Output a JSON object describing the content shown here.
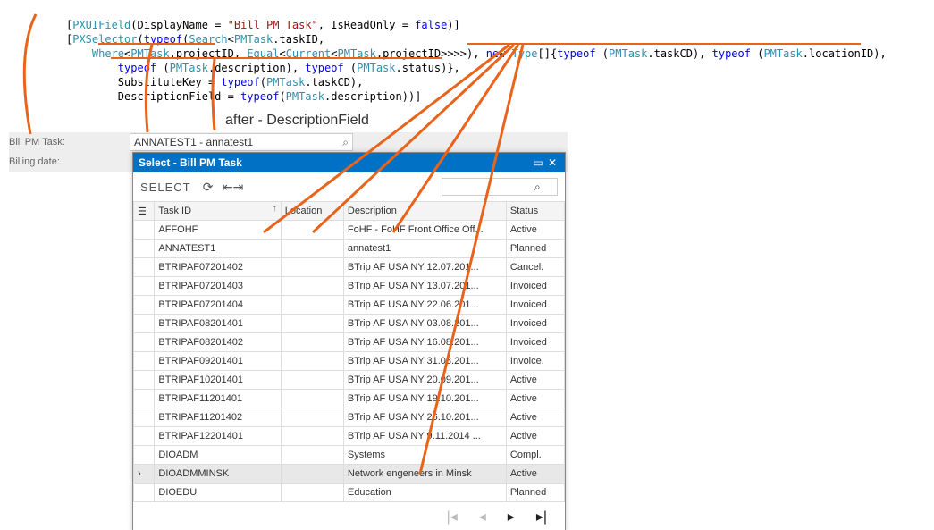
{
  "code": {
    "l1a": "[",
    "l1b": "PXUIField",
    "l1c": "(DisplayName = ",
    "l1d": "\"Bill PM Task\"",
    "l1e": ", IsReadOnly = ",
    "l1f": "false",
    "l1g": ")]",
    "l2a": "[",
    "l2b": "PXSelector",
    "l2c": "(",
    "l2d": "typeof",
    "l2e": "(",
    "l2f": "Search",
    "l2g": "<",
    "l2h": "PMTask",
    "l2i": ".taskID,",
    "l3a": "    ",
    "l3b": "Where",
    "l3c": "<",
    "l3d": "PMTask",
    "l3e": ".projectID, ",
    "l3f": "Equal",
    "l3g": "<",
    "l3h": "Current",
    "l3i": "<",
    "l3j": "PMTask",
    "l3k": ".projectID>>>>), ",
    "l3l": "new",
    "l3m": " ",
    "l3n": "Type",
    "l3o": "[]{",
    "l3p": "typeof",
    "l3q": " (",
    "l3r": "PMTask",
    "l3s": ".taskCD), ",
    "l3t": "typeof",
    "l3u": " (",
    "l3v": "PMTask",
    "l3w": ".locationID),",
    "l4a": "        ",
    "l4b": "typeof",
    "l4c": " (",
    "l4d": "PMTask",
    "l4e": ".description), ",
    "l4f": "typeof",
    "l4g": " (",
    "l4h": "PMTask",
    "l4i": ".status)},",
    "l5a": "        SubstituteKey = ",
    "l5b": "typeof",
    "l5c": "(",
    "l5d": "PMTask",
    "l5e": ".taskCD),",
    "l6a": "        DescriptionField = ",
    "l6b": "typeof",
    "l6c": "(",
    "l6d": "PMTask",
    "l6e": ".description))]"
  },
  "annot": {
    "after": "after - DescriptionField"
  },
  "form": {
    "label1": "Bill PM Task:",
    "value1": "ANNATEST1 - annatest1",
    "search_icon": "⌕",
    "label2": "Billing date:"
  },
  "popup": {
    "title": "Select - Bill PM Task",
    "pin": "▭",
    "close": "✕",
    "select": "SELECT",
    "refresh": "⟳",
    "fit": "⇤⇥",
    "cols": {
      "sel": "☰",
      "id": "Task ID",
      "loc": "Location",
      "desc": "Description",
      "stat": "Status"
    },
    "rows": [
      {
        "id": "AFFOHF",
        "loc": "",
        "desc": "FoHF - FoHF Front Office Off...",
        "stat": "Active"
      },
      {
        "id": "ANNATEST1",
        "loc": "",
        "desc": "annatest1",
        "stat": "Planned"
      },
      {
        "id": "BTRIPAF07201402",
        "loc": "",
        "desc": "BTrip AF USA NY 12.07.201...",
        "stat": "Cancel."
      },
      {
        "id": "BTRIPAF07201403",
        "loc": "",
        "desc": "BTrip AF USA NY 13.07.201...",
        "stat": "Invoiced"
      },
      {
        "id": "BTRIPAF07201404",
        "loc": "",
        "desc": "BTrip AF USA NY 22.06.201...",
        "stat": "Invoiced"
      },
      {
        "id": "BTRIPAF08201401",
        "loc": "",
        "desc": "BTrip AF USA NY 03.08.201...",
        "stat": "Invoiced"
      },
      {
        "id": "BTRIPAF08201402",
        "loc": "",
        "desc": "BTrip AF USA NY 16.08.201...",
        "stat": "Invoiced"
      },
      {
        "id": "BTRIPAF09201401",
        "loc": "",
        "desc": "BTrip AF USA NY 31.08.201...",
        "stat": "Invoice."
      },
      {
        "id": "BTRIPAF10201401",
        "loc": "",
        "desc": "BTrip AF USA NY 20.09.201...",
        "stat": "Active"
      },
      {
        "id": "BTRIPAF11201401",
        "loc": "",
        "desc": "BTrip AF USA NY 19.10.201...",
        "stat": "Active"
      },
      {
        "id": "BTRIPAF11201402",
        "loc": "",
        "desc": "BTrip AF USA NY 26.10.201...",
        "stat": "Active"
      },
      {
        "id": "BTRIPAF12201401",
        "loc": "",
        "desc": "BTrip AF USA NY 9.11.2014 ...",
        "stat": "Active"
      },
      {
        "id": "DIOADM",
        "loc": "",
        "desc": "Systems",
        "stat": "Compl."
      },
      {
        "id": "DIOADMMINSK",
        "loc": "",
        "desc": "Network engeneers in Minsk",
        "stat": "Active",
        "sel": true
      },
      {
        "id": "DIOEDU",
        "loc": "",
        "desc": "Education",
        "stat": "Planned"
      }
    ],
    "pager": {
      "first": "|◂",
      "prev": "◂",
      "next": "▸",
      "last": "▸|"
    }
  }
}
